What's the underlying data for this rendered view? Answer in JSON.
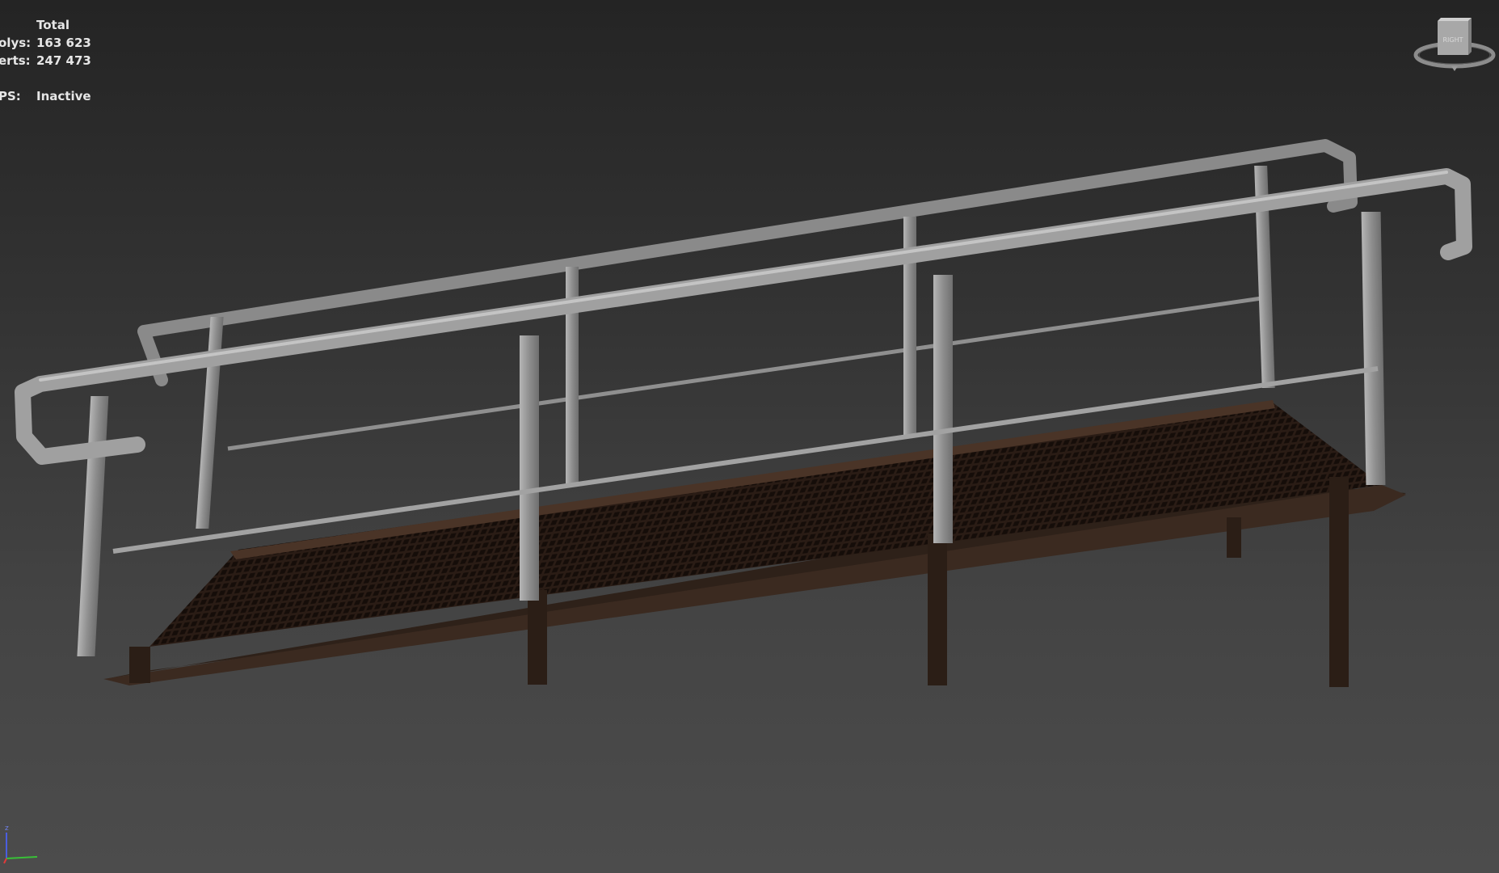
{
  "viewport": {
    "stats": {
      "header": "Total",
      "polys_label": "olys:",
      "polys_value": "163 623",
      "verts_label": "erts:",
      "verts_value": "247 473",
      "fps_label": "PS:",
      "fps_value": "Inactive"
    },
    "viewcube": {
      "face_label": "RIGHT"
    },
    "axis": {
      "z_label": "z"
    },
    "colors": {
      "background_top": "#242424",
      "background_bottom": "#4c4c4c",
      "railing": "#9a9a9a",
      "deck": "#3b2a20",
      "text": "#e6e6e6"
    }
  }
}
